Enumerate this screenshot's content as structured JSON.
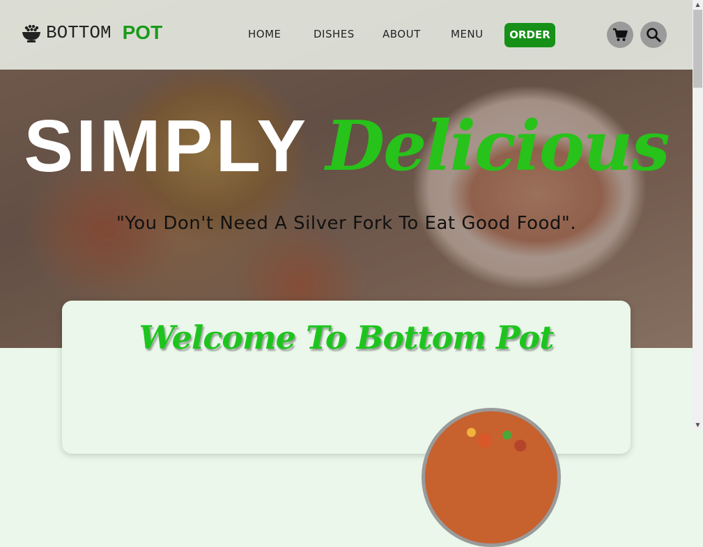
{
  "header": {
    "logo": {
      "part1": "BOTTOM",
      "part2": "POT"
    },
    "nav": [
      {
        "label": "HOME"
      },
      {
        "label": "DISHES"
      },
      {
        "label": "ABOUT"
      },
      {
        "label": "MENU"
      }
    ],
    "order_label": "ORDER",
    "icons": {
      "cart": "shopping-cart-icon",
      "search": "search-icon",
      "logo": "rice-bowl-icon"
    }
  },
  "hero": {
    "title_part1": "SIMPLY",
    "title_part2": "Delicious",
    "quote": "\"You Don't Need A Silver Fork To Eat Good Food\"."
  },
  "welcome": {
    "title": "Welcome To Bottom Pot"
  },
  "colors": {
    "brand_green": "#179017",
    "accent_green": "#27c21a",
    "page_background": "#eaf7ea"
  }
}
